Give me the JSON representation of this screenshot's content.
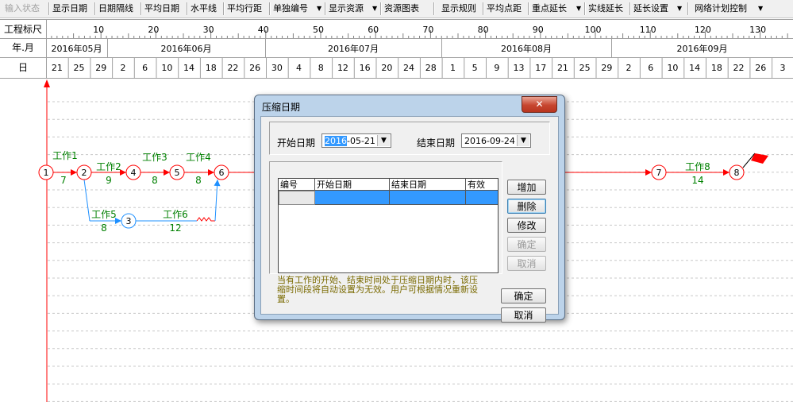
{
  "toolbar": {
    "items": [
      "输入状态",
      "显示日期",
      "日期隔线",
      "平均日期",
      "水平线",
      "平均行距",
      "单独编号",
      "显示资源",
      "资源图表",
      "显示规则",
      "平均点距",
      "重点延长",
      "实线延长",
      "延长设置",
      "网络计划控制"
    ],
    "dropdown_arrow": "▼"
  },
  "timescale": {
    "row_labels": [
      "工程标尺",
      "年.月",
      "日"
    ],
    "ruler_ticks": [
      "10",
      "20",
      "30",
      "40",
      "50",
      "60",
      "70",
      "80",
      "90",
      "100",
      "110",
      "120",
      "130"
    ],
    "months": [
      "2016年05月",
      "2016年06月",
      "2016年07月",
      "2016年08月",
      "2016年09月"
    ],
    "days": [
      "21",
      "25",
      "29",
      "2",
      "6",
      "10",
      "14",
      "18",
      "22",
      "26",
      "30",
      "4",
      "8",
      "12",
      "16",
      "20",
      "24",
      "28",
      "1",
      "5",
      "9",
      "13",
      "17",
      "21",
      "25",
      "29",
      "2",
      "6",
      "10",
      "14",
      "18",
      "22",
      "26",
      "3"
    ]
  },
  "network": {
    "nodes": [
      "1",
      "2",
      "3",
      "4",
      "5",
      "6",
      "7",
      "8"
    ],
    "tasks": [
      {
        "name": "工作1",
        "duration": "7"
      },
      {
        "name": "工作2",
        "duration": "9"
      },
      {
        "name": "工作3",
        "duration": "8"
      },
      {
        "name": "工作4",
        "duration": "8"
      },
      {
        "name": "工作5",
        "duration": "8"
      },
      {
        "name": "工作6",
        "duration": "12"
      },
      {
        "name": "工作8",
        "duration": "14"
      }
    ],
    "colors": {
      "critical": "#ff0000",
      "normal": "#1e90ff",
      "label": "#008000",
      "grid": "#c8c8c8"
    }
  },
  "dialog": {
    "title": "压缩日期",
    "close_symbol": "✕",
    "start_label": "开始日期",
    "start_value_selected": "2016",
    "start_value_rest": "-05-21",
    "end_label": "结束日期",
    "end_value": "2016-09-24",
    "combo_arrow": "▼",
    "columns": [
      "编号",
      "开始日期",
      "结束日期",
      "有效"
    ],
    "buttons": {
      "add": "增加",
      "delete": "删除",
      "modify": "修改",
      "confirm_inner": "确定",
      "cancel_inner": "取消",
      "ok": "确定",
      "cancel": "取消"
    },
    "notice": "当有工作的开始、结束时间处于压缩日期内时，该压缩时间段将自动设置为无效。用户可根据情况重新设置。"
  }
}
